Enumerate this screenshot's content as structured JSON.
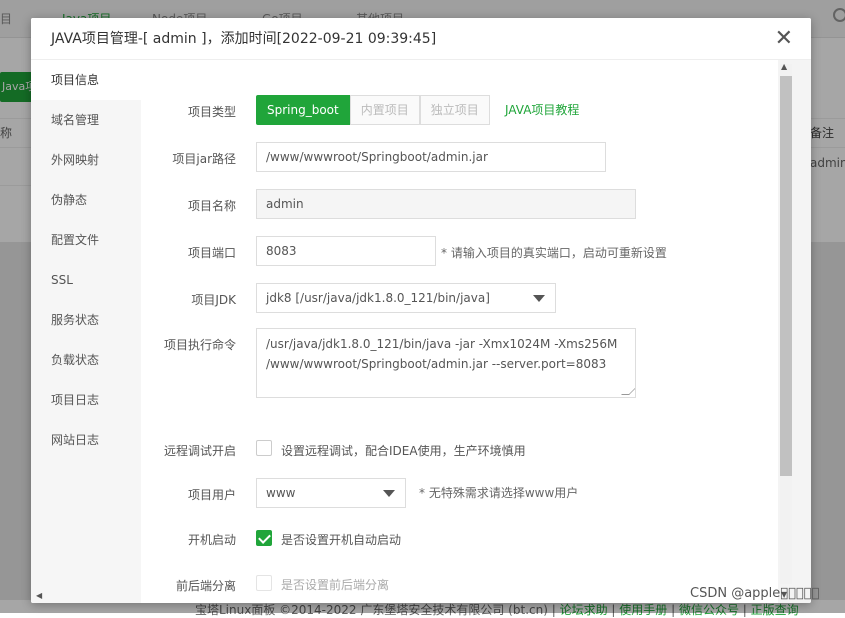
{
  "background": {
    "tabs": [
      "目",
      "Java项目",
      "Node项目",
      "Go项目",
      "其他项目"
    ],
    "green_button": "Java项目",
    "left_header": "称",
    "right_header": "备注",
    "right_value": "admin",
    "footer_text": "宝塔Linux面板 ©2014-2022 广东堡塔安全技术有限公司 (bt.cn)",
    "footer_links": [
      "论坛求助",
      "使用手册",
      "微信公众号",
      "正版查询"
    ]
  },
  "dialog": {
    "title": "JAVA项目管理-[ admin ]，添加时间[2022-09-21 09:39:45]",
    "close_icon": "close-icon",
    "sidebar": [
      "项目信息",
      "域名管理",
      "外网映射",
      "伪静态",
      "配置文件",
      "SSL",
      "服务状态",
      "负载状态",
      "项目日志",
      "网站日志"
    ],
    "active_tab": "项目信息"
  },
  "form": {
    "type_label": "项目类型",
    "type_options": [
      "Spring_boot",
      "内置项目",
      "独立项目"
    ],
    "type_selected": "Spring_boot",
    "tutorial_link": "JAVA项目教程",
    "jar_label": "项目jar路径",
    "jar_value": "/www/wwwroot/Springboot/admin.jar",
    "name_label": "项目名称",
    "name_value": "admin",
    "port_label": "项目端口",
    "port_value": "8083",
    "port_hint": "* 请输入项目的真实端口，启动可重新设置",
    "jdk_label": "项目JDK",
    "jdk_value": "jdk8 [/usr/java/jdk1.8.0_121/bin/java]",
    "cmd_label": "项目执行命令",
    "cmd_line1": "/usr/java/jdk1.8.0_121/bin/java -jar -Xmx1024M -Xms256M",
    "cmd_line2": "/www/wwwroot/Springboot/admin.jar --server.port=8083",
    "debug_label": "远程调试开启",
    "debug_text": "设置远程调试，配合IDEA使用，生产环境慎用",
    "debug_checked": false,
    "user_label": "项目用户",
    "user_value": "www",
    "user_hint": "* 无特殊需求请选择www用户",
    "boot_label": "开机启动",
    "boot_text": "是否设置开机自动启动",
    "boot_checked": true,
    "split_label": "前后端分离",
    "split_text": "是否设置前后端分离",
    "split_checked": false
  },
  "watermark": "CSDN @apple\u0000\u0000\u0000\u0000\u0000",
  "colors": {
    "accent": "#20a53a",
    "overlay": "rgba(0,0,0,0.35)"
  }
}
